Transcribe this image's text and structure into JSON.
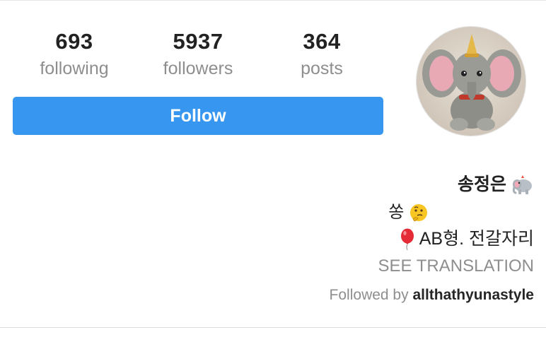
{
  "stats": {
    "following": {
      "count": "693",
      "label": "following"
    },
    "followers": {
      "count": "5937",
      "label": "followers"
    },
    "posts": {
      "count": "364",
      "label": "posts"
    }
  },
  "follow_button": {
    "label": "Follow"
  },
  "colors": {
    "follow_button": "#3797f0",
    "secondary_text": "#8e8e8e",
    "primary_text": "#262626"
  },
  "bio": {
    "name": "송정은",
    "name_emoji": "elephant-icon",
    "line1_text": "쏭",
    "line1_emoji": "thinking-face-icon",
    "line2_emoji": "balloon-icon",
    "line2_text": "AB형. 전갈자리",
    "see_translation": "SEE TRANSLATION",
    "followed_by_prefix": "Followed by ",
    "followed_by_user": "allthathyunastyle"
  },
  "avatar": {
    "icon": "dumbo-plush-photo"
  }
}
